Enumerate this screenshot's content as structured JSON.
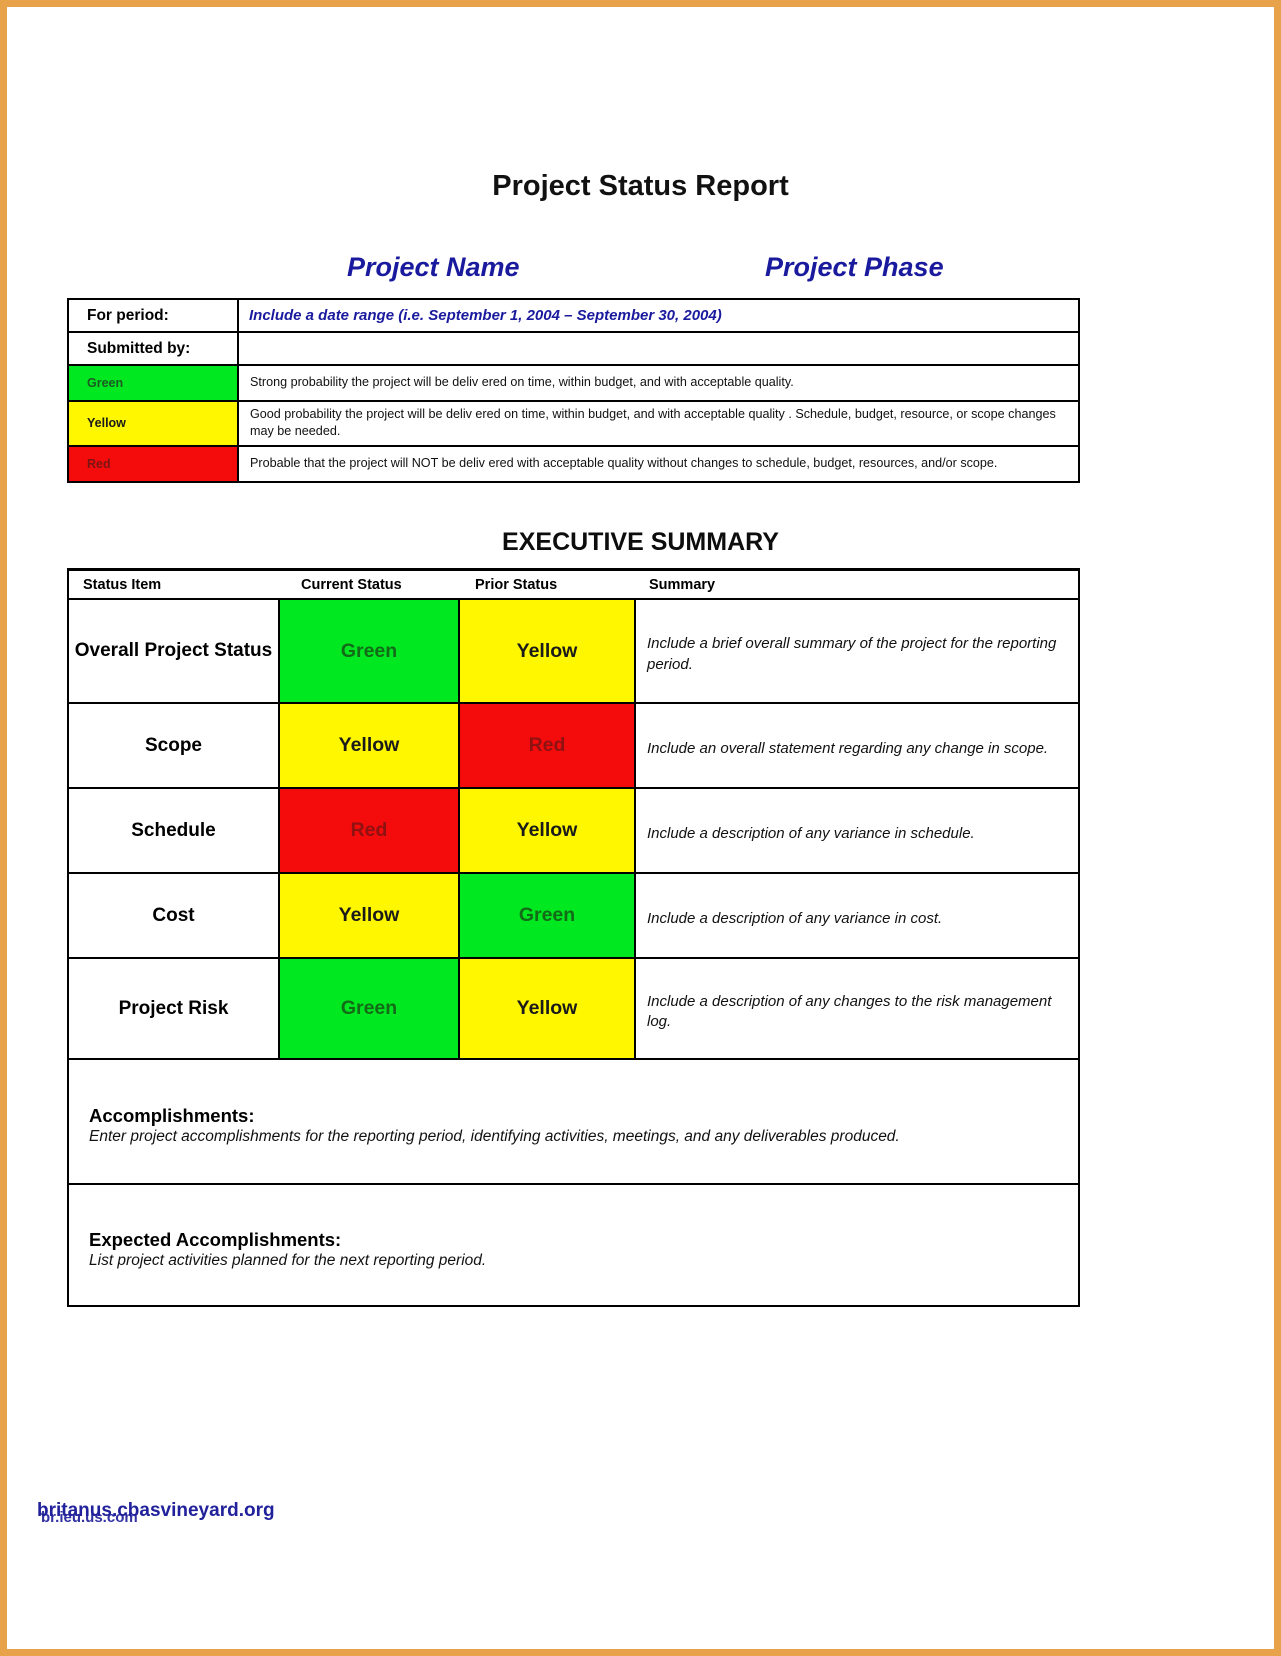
{
  "document": {
    "title": "Project Status Report",
    "project_name_header": "Project Name",
    "project_phase_header": "Project Phase"
  },
  "info": {
    "for_period_label": "For period:",
    "for_period_value": "Include a date range (i.e. September 1, 2004 – September 30, 2004)",
    "submitted_by_label": "Submitted by:",
    "submitted_by_value": "",
    "legend": [
      {
        "label": "Green",
        "color": "#00e820",
        "description": "Strong probability  the project will be deliv ered on time, within budget, and with acceptable quality."
      },
      {
        "label": "Yellow",
        "color": "#fff700",
        "description": "Good probability the project will be deliv ered on time, within budget, and with acceptable quality . Schedule, budget, resource, or scope changes may be needed."
      },
      {
        "label": "Red",
        "color": "#f40c0c",
        "description": "Probable that the project will NOT be deliv ered with acceptable quality without changes to schedule, budget, resources, and/or scope."
      }
    ]
  },
  "executive_summary": {
    "heading": "EXECUTIVE SUMMARY",
    "columns": [
      "Status Item",
      "Current Status",
      "Prior Status",
      "Summary"
    ],
    "rows": [
      {
        "item": "Overall Project Status",
        "current_status": "Green",
        "current_color": "#00e820",
        "prior_status": "Yellow",
        "prior_color": "#fff700",
        "summary": "Include a brief overall summary of the project for the reporting period."
      },
      {
        "item": "Scope",
        "current_status": "Yellow",
        "current_color": "#fff700",
        "prior_status": "Red",
        "prior_color": "#f40c0c",
        "summary": "Include an overall statement regarding any change in scope."
      },
      {
        "item": "Schedule",
        "current_status": "Red",
        "current_color": "#f40c0c",
        "prior_status": "Yellow",
        "prior_color": "#fff700",
        "summary": "Include a description of any variance in schedule."
      },
      {
        "item": "Cost",
        "current_status": "Yellow",
        "current_color": "#fff700",
        "prior_status": "Green",
        "prior_color": "#00e820",
        "summary": "Include a description of any variance in cost."
      },
      {
        "item": "Project Risk",
        "current_status": "Green",
        "current_color": "#00e820",
        "prior_status": "Yellow",
        "prior_color": "#fff700",
        "summary": "Include a description of any changes to the risk management log."
      }
    ],
    "accomplishments": {
      "heading": "Accomplishments:",
      "hint": "Enter project accomplishments for the reporting period, identifying activities, meetings, and any deliverables produced."
    },
    "expected_accomplishments": {
      "heading": "Expected Accomplishments:",
      "hint": "List project activities planned for the next reporting period."
    }
  },
  "footer": {
    "watermark_primary": "britanus.cbasvineyard.org",
    "watermark_secondary": "br.ieu.us.com"
  }
}
